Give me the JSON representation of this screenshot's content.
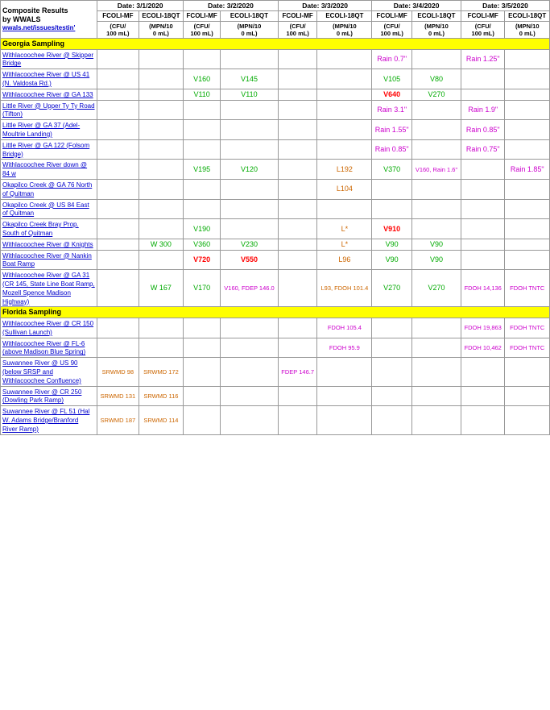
{
  "title": "Composite Results by WWALS",
  "wwals_link1": "wwals.net/issues/testin'",
  "wwals_link2": "wwals.net/issues/testin'",
  "dates": [
    "3/1/2020",
    "3/2/2020",
    "3/3/2020",
    "3/4/2020",
    "3/5/2020"
  ],
  "col_headers": {
    "fcoli_mf": "FCOLI-MF",
    "ecoli_18qt": "ECOLI-18QT",
    "cfu": "(CFU/100 mL)",
    "mpn": "(MPN/100 mL)"
  },
  "sections": [
    {
      "name": "Georgia Sampling",
      "type": "section-header",
      "rows": [
        {
          "site": "Withlacoochee River @ Skipper Bridge",
          "data": [
            [
              "",
              "",
              "",
              "",
              "",
              "",
              "Rain 0.7\"",
              "",
              "Rain 1.25\"",
              ""
            ]
          ]
        },
        {
          "site": "Withlacoochee River @ US 41 (N. Valdosta Rd.)",
          "data": [
            [
              "",
              "",
              "V160",
              "V145",
              "",
              "",
              "V105",
              "V80",
              "",
              ""
            ]
          ]
        },
        {
          "site": "Withlacoochee River @ GA 133",
          "data": [
            [
              "",
              "",
              "V110",
              "V110",
              "",
              "",
              "V640",
              "V270",
              "",
              ""
            ]
          ]
        },
        {
          "site": "Little River @ Upper Ty Ty Road (Tifton)",
          "data": [
            [
              "",
              "",
              "",
              "",
              "",
              "",
              "Rain 3.1\"",
              "",
              "Rain 1.9\"",
              ""
            ]
          ]
        },
        {
          "site": "Little River @ GA 37 (Adel-Moultrie Landing)",
          "data": [
            [
              "",
              "",
              "",
              "",
              "",
              "",
              "Rain 1.55\"",
              "",
              "Rain 0.85\"",
              ""
            ]
          ]
        },
        {
          "site": "Little River @ GA 122 (Folsom Bridge)",
          "data": [
            [
              "",
              "",
              "",
              "",
              "",
              "",
              "Rain 0.85\"",
              "",
              "Rain 0.75\"",
              ""
            ]
          ]
        },
        {
          "site": "Withlacoochee River down @ 84 w",
          "data": [
            [
              "",
              "",
              "V195",
              "V120",
              "",
              "L192",
              "V370",
              "V160, Rain 1.6\"",
              "",
              "Rain 1.85\""
            ]
          ]
        },
        {
          "site": "Okapilco Creek @ GA 76 North of Quitman",
          "data": [
            [
              "",
              "",
              "",
              "",
              "",
              "L104",
              "",
              "",
              "",
              ""
            ]
          ]
        },
        {
          "site": "Okapilco Creek @ US 84 East of Quitman",
          "data": [
            [
              "",
              "",
              "",
              "",
              "",
              "",
              "",
              "",
              "",
              ""
            ]
          ]
        },
        {
          "site": "Okapilco Creek Bray Prop. South of Quitman",
          "data": [
            [
              "",
              "",
              "V190",
              "",
              "",
              "L*",
              "V910",
              "",
              "",
              ""
            ]
          ]
        },
        {
          "site": "Withlacoochee River @ Knights",
          "data": [
            [
              "",
              "W 300",
              "V360",
              "V230",
              "",
              "L*",
              "V90",
              "V90",
              "",
              ""
            ]
          ]
        },
        {
          "site": "Withlacoochee River @ Nankin Boat Ramp",
          "data": [
            [
              "",
              "",
              "V720",
              "V550",
              "",
              "L96",
              "V90",
              "V90",
              "",
              ""
            ]
          ]
        },
        {
          "site": "Withlacoochee River @ GA 31 (CR 145, State Line Boat Ramp, Mozell Spence Madison Highway)",
          "data": [
            [
              "",
              "W 167",
              "V170",
              "V160, FDEP 146.0",
              "",
              "L93, FDOH 101.4",
              "V270",
              "V270",
              "FDOH 14,136",
              "FDOH TNTC"
            ]
          ]
        }
      ]
    },
    {
      "name": "Florida Sampling",
      "type": "section-header",
      "rows": [
        {
          "site": "Withlacoochee River @ CR 150 (Sullivan Launch)",
          "data": [
            [
              "",
              "",
              "",
              "",
              "",
              "FDOH 105.4",
              "",
              "",
              "FDOH 19,863",
              "FDOH TNTC"
            ]
          ]
        },
        {
          "site": "Withlacoochee River @ FL-6 (above Madison Blue Spring)",
          "data": [
            [
              "",
              "",
              "",
              "",
              "",
              "FDOH 95.9",
              "",
              "",
              "FDOH 10,462",
              "FDOH TNTC"
            ]
          ]
        },
        {
          "site": "Suwannee River @ US 90 (below SRSP and Withlacoochee Confluence)",
          "data": [
            [
              "SRWMD 98",
              "SRWMD 172",
              "",
              "",
              "FDEP 146.7",
              "",
              "",
              "",
              "",
              ""
            ]
          ]
        },
        {
          "site": "Suwannee River @ CR 250 (Dowling Park Ramp)",
          "data": [
            [
              "SRWMD 131",
              "SRWMD 116",
              "",
              "",
              "",
              "",
              "",
              "",
              "",
              ""
            ]
          ]
        },
        {
          "site": "Suwannee River @ FL 51 (Hal W. Adams Bridge/Branford River Ramp)",
          "data": [
            [
              "SRWMD 187",
              "SRWMD 114",
              "",
              "",
              "",
              "",
              "",
              "",
              "",
              ""
            ]
          ]
        }
      ]
    }
  ]
}
